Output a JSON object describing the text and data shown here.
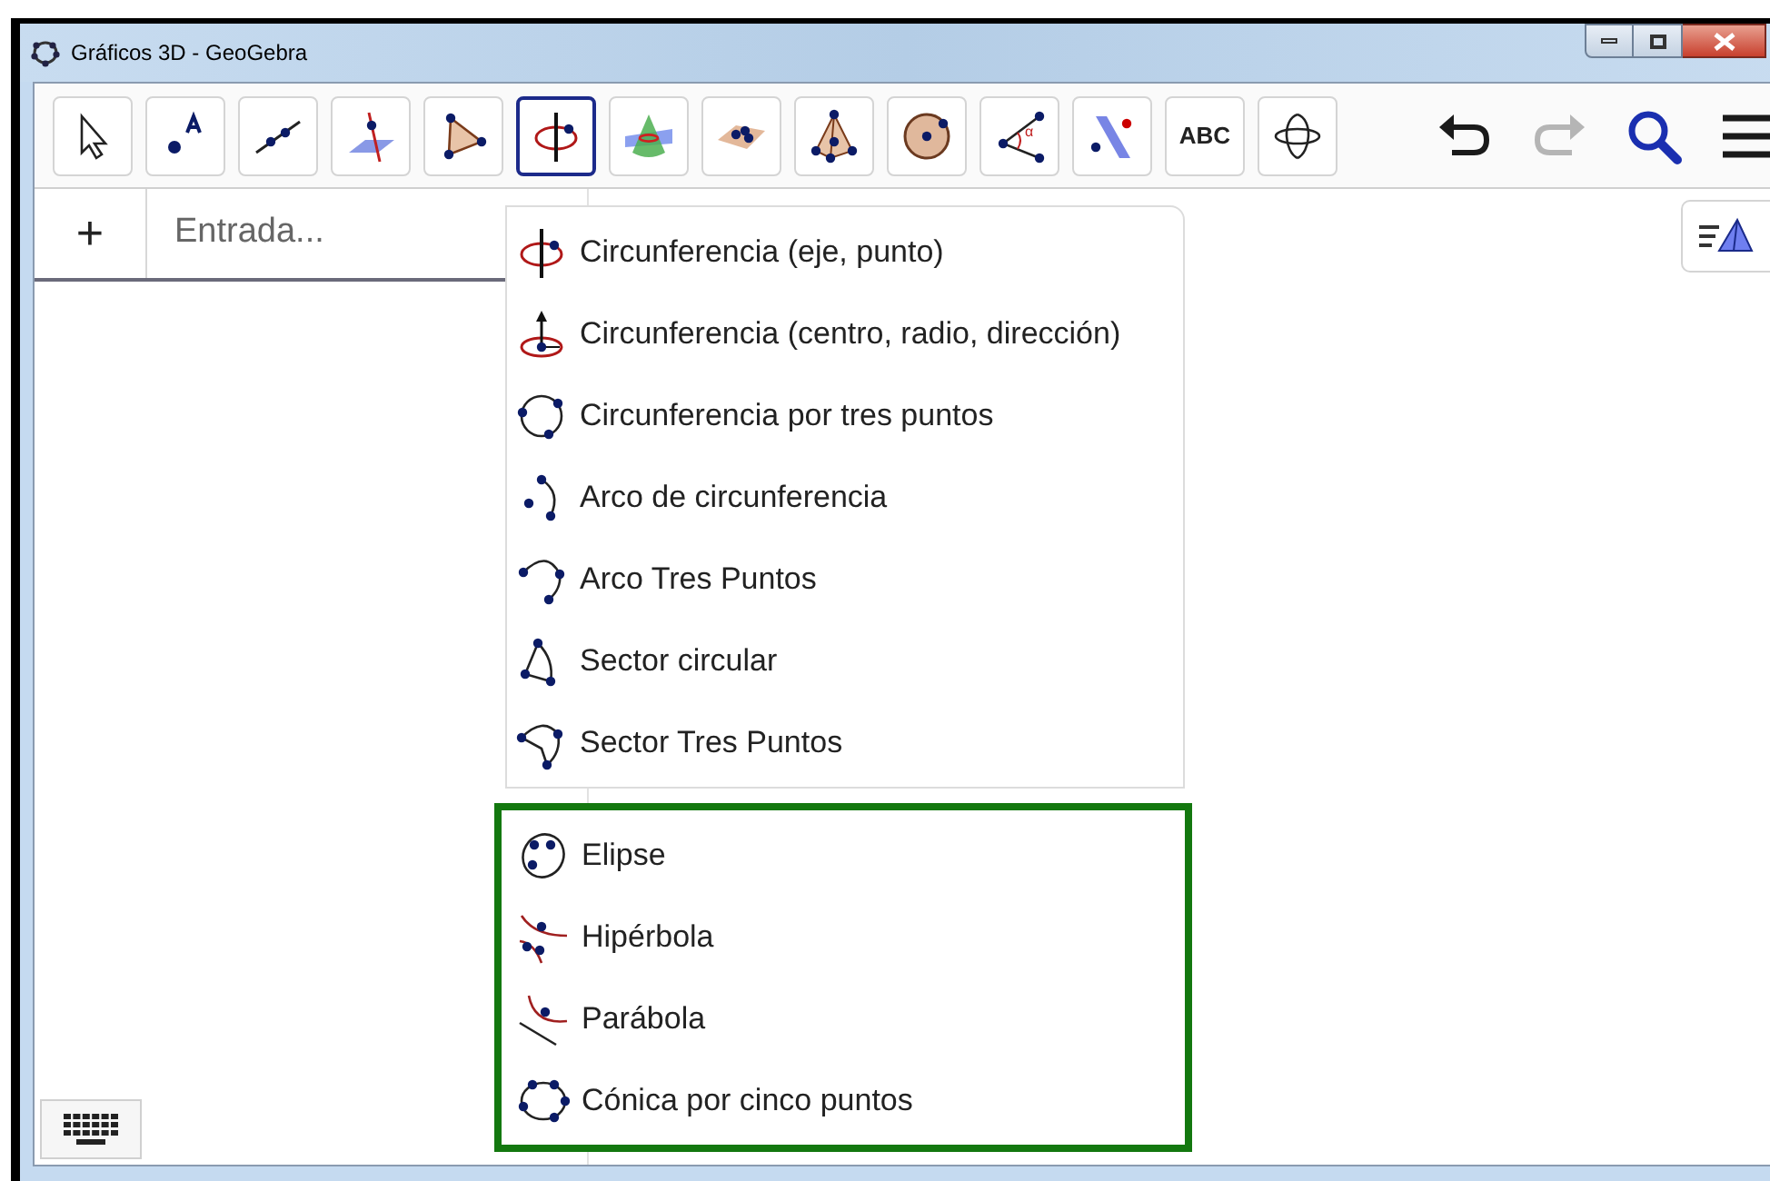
{
  "window": {
    "title": "Gráficos 3D - GeoGebra"
  },
  "toolbar": {
    "tools": [
      {
        "kind": "move",
        "selected": false
      },
      {
        "kind": "point",
        "selected": false
      },
      {
        "kind": "line",
        "selected": false
      },
      {
        "kind": "perpendicular",
        "selected": false
      },
      {
        "kind": "polygon",
        "selected": false
      },
      {
        "kind": "circle-axis",
        "selected": true
      },
      {
        "kind": "intersect",
        "selected": false
      },
      {
        "kind": "plane",
        "selected": false
      },
      {
        "kind": "pyramid",
        "selected": false
      },
      {
        "kind": "sphere",
        "selected": false
      },
      {
        "kind": "angle",
        "label": "α",
        "selected": false
      },
      {
        "kind": "reflect",
        "selected": false
      },
      {
        "kind": "text",
        "label": "ABC",
        "selected": false
      },
      {
        "kind": "rotate",
        "selected": false
      }
    ],
    "actions": [
      {
        "kind": "undo",
        "disabled": false
      },
      {
        "kind": "redo",
        "disabled": true
      },
      {
        "kind": "search",
        "disabled": false
      },
      {
        "kind": "menu",
        "disabled": false
      }
    ]
  },
  "algebra": {
    "add_button": "+",
    "input": {
      "placeholder": "Entrada..."
    }
  },
  "tool_menu": {
    "groups": [
      {
        "framed": false,
        "items": [
          {
            "kind": "circle-axis",
            "label": "Circunferencia (eje, punto)"
          },
          {
            "kind": "circle-center-direction",
            "label": "Circunferencia (centro, radio, dirección)"
          },
          {
            "kind": "circle-three",
            "label": "Circunferencia por tres puntos"
          },
          {
            "kind": "arc",
            "label": "Arco de circunferencia"
          },
          {
            "kind": "arc-three",
            "label": "Arco Tres Puntos"
          },
          {
            "kind": "sector",
            "label": "Sector circular"
          },
          {
            "kind": "sector-three",
            "label": "Sector Tres Puntos"
          }
        ]
      },
      {
        "framed": true,
        "items": [
          {
            "kind": "ellipse",
            "label": "Elipse"
          },
          {
            "kind": "hyperbola",
            "label": "Hipérbola"
          },
          {
            "kind": "parabola",
            "label": "Parábola"
          },
          {
            "kind": "conic-five",
            "label": "Cónica por cinco puntos"
          }
        ]
      }
    ]
  }
}
